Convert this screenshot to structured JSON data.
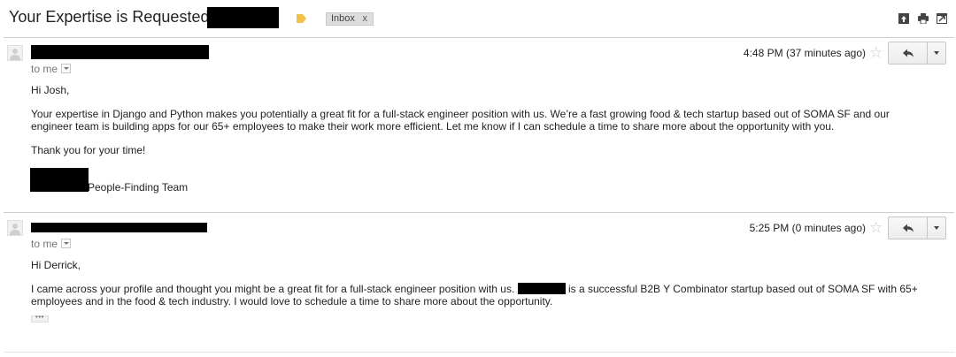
{
  "thread": {
    "subject": "Your Expertise is Requested at",
    "inbox_chip": "Inbox",
    "inbox_chip_remove": "x",
    "label_color": "#f2c14b"
  },
  "toolbar_icons": [
    "archive-icon",
    "print-icon",
    "new-window-icon"
  ],
  "messages": [
    {
      "to_line": "to me",
      "timestamp": "4:48 PM (37 minutes ago)",
      "greeting": "Hi Josh,",
      "paragraph": "Your expertise in Django and Python makes you potentially a great fit for a full-stack engineer position with us. We’re a fast growing food & tech startup based out of SOMA SF and our engineer team is building apps for our 65+ employees to make their work more efficient. Let me know if I can schedule a time to share more about the opportunity with you.",
      "closing": "Thank you for your time!",
      "signature": "People-Finding Team"
    },
    {
      "to_line": "to me",
      "timestamp": "5:25 PM (0 minutes ago)",
      "greeting": "Hi Derrick,",
      "paragraph_before": "I came across your profile and thought you might be a great fit for a full-stack engineer position with us.",
      "paragraph_after": "is a successful B2B Y Combinator startup based out of SOMA SF with 65+ employees and in the food & tech industry. I would love to schedule a time to share more about the opportunity.",
      "trimmed_content": "•••"
    }
  ],
  "star_glyph": "☆"
}
